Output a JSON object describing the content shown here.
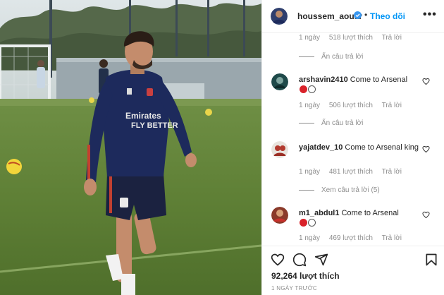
{
  "header": {
    "username": "houssem_aouar",
    "follow_label": "Theo dõi",
    "separator": "•",
    "more_label": "•••"
  },
  "comments": {
    "top_partial_meta": {
      "time": "1 ngày",
      "likes": "518 lượt thích",
      "reply": "Trả lời"
    },
    "top_hide_replies": "Ẩn câu trả lời",
    "items": [
      {
        "username": "arshavin2410",
        "text": "Come to Arsenal",
        "emoji": [
          "red-circle",
          "white-circle"
        ],
        "time": "1 ngày",
        "likes": "506 lượt thích",
        "reply": "Trả lời",
        "replies_toggle": "Ẩn câu trả lời"
      },
      {
        "username": "yajatdev_10",
        "text": "Come to Arsenal king",
        "emoji": [],
        "time": "1 ngày",
        "likes": "481 lượt thích",
        "reply": "Trả lời",
        "replies_toggle": "Xem câu trả lời (5)"
      },
      {
        "username": "m1_abdul1",
        "text": "Come to Arsenal",
        "emoji": [
          "red-circle",
          "white-circle"
        ],
        "time": "1 ngày",
        "likes": "469 lượt thích",
        "reply": "Trả lời",
        "replies_toggle": ""
      }
    ]
  },
  "actions": {
    "icons": [
      "heart-icon",
      "comment-icon",
      "share-icon",
      "bookmark-icon"
    ],
    "likes": "92,264 lượt thích",
    "time_ago": "1 NGÀY TRƯỚC"
  },
  "colors": {
    "link_blue": "#0095f6",
    "meta_gray": "#8e8e8e",
    "text_dark": "#262626",
    "emoji_red": "#d9222a"
  }
}
